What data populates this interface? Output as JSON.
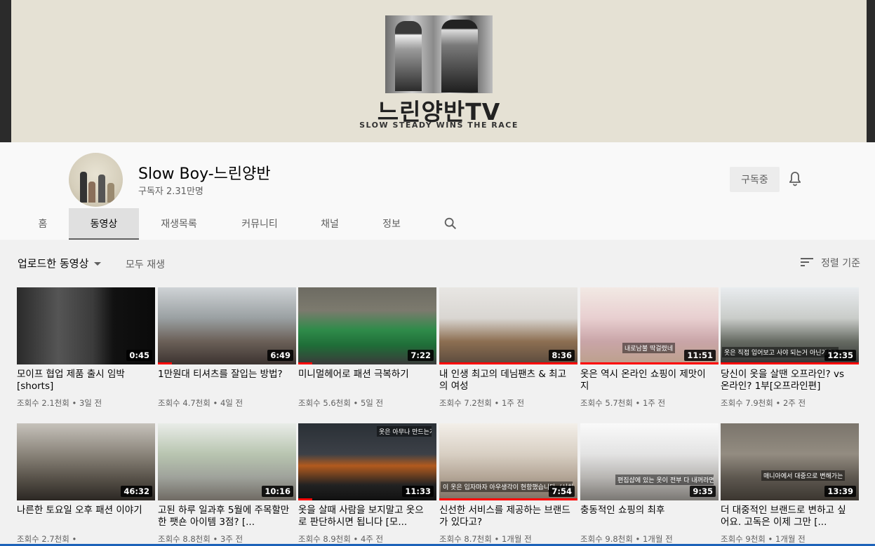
{
  "banner": {
    "title": "느린양반TV",
    "subtitle": "SLOW STEADY WINS THE RACE"
  },
  "channel": {
    "name": "Slow Boy-느린양반",
    "subscribers": "구독자 2.31만명",
    "subscribe_label": "구독중"
  },
  "tabs": [
    "홈",
    "동영상",
    "재생목록",
    "커뮤니티",
    "채널",
    "정보"
  ],
  "active_tab": "동영상",
  "filter": {
    "sort_dropdown": "업로드한 동영상",
    "play_all": "모두 재생",
    "sort_by": "정렬 기준"
  },
  "videos": [
    {
      "title": "모이프 협업 제품 출시 임박 [shorts]",
      "views": "조회수 2.1천회",
      "age": "3일 전",
      "duration": "0:45",
      "overlay": "",
      "progress": 0
    },
    {
      "title": "1만원대 티셔츠를 잘입는 방법?",
      "views": "조회수 4.7천회",
      "age": "4일 전",
      "duration": "6:49",
      "overlay": "",
      "progress": 0.1
    },
    {
      "title": "미니멀헤어로 패션 극복하기",
      "views": "조회수 5.6천회",
      "age": "5일 전",
      "duration": "7:22",
      "overlay": "",
      "progress": 0.1
    },
    {
      "title": "내 인생 최고의 데님팬츠 & 최고의 여성",
      "views": "조회수 7.2천회",
      "age": "1주 전",
      "duration": "8:36",
      "overlay": "",
      "progress": 1.0
    },
    {
      "title": "옷은 역시 온라인 쇼핑이 제맛이지",
      "views": "조회수 5.7천회",
      "age": "1주 전",
      "duration": "11:51",
      "overlay": "내로남불 딱걸렸네",
      "progress": 1.0
    },
    {
      "title": "당신이 옷을 살땐 오프라인? vs 온라인? 1부[오프라인편]",
      "views": "조회수 7.9천회",
      "age": "2주 전",
      "duration": "12:35",
      "overlay": "옷은 직접 입어보고 사야 되는거 아닌가요?",
      "progress": 1.0
    },
    {
      "title": "나른한 토요일 오후 패션 이야기",
      "views": "조회수 2.7천회",
      "age": "",
      "duration": "46:32",
      "overlay": "",
      "progress": 0
    },
    {
      "title": "고된 하루 일과후 5월에 주목할만한 팻숀 아이템 3점? [...",
      "views": "조회수 8.8천회",
      "age": "3주 전",
      "duration": "10:16",
      "overlay": "",
      "progress": 0
    },
    {
      "title": "옷을 살때 사람을 보지말고 옷으로 판단하시면 됩니다 [모...",
      "views": "조회수 8.9천회",
      "age": "4주 전",
      "duration": "11:33",
      "overlay": "옷은 아무나 만드는게 아니더라",
      "progress": 0.1
    },
    {
      "title": "신선한 서비스를 제공하는 브랜드가 있다고?",
      "views": "조회수 8.7천회",
      "age": "1개월 전",
      "duration": "7:54",
      "overlay": "이 옷은 입자마자 아우생각이 현함했습니다. (서치보이)",
      "progress": 1.0
    },
    {
      "title": "충동적인 쇼핑의 최후",
      "views": "조회수 9.8천회",
      "age": "1개월 전",
      "duration": "9:35",
      "overlay": "편집샵에 있는 옷이 전부 다 내꺼라면 어떤 기분일까?",
      "progress": 0
    },
    {
      "title": "더 대중적인 브랜드로 변하고 싶어요. 고독은 이제 그만 [...",
      "views": "조회수 9천회",
      "age": "1개월 전",
      "duration": "13:39",
      "overlay": "매니아에서 대중으로 변해가는",
      "progress": 0
    }
  ],
  "colors": {
    "banner_bg": "#e5e1d4",
    "header_bg": "#f9f9f9",
    "page_bg": "#f1f1f1",
    "progress_red": "#ff0000",
    "subscribe_bg": "#ececec"
  }
}
